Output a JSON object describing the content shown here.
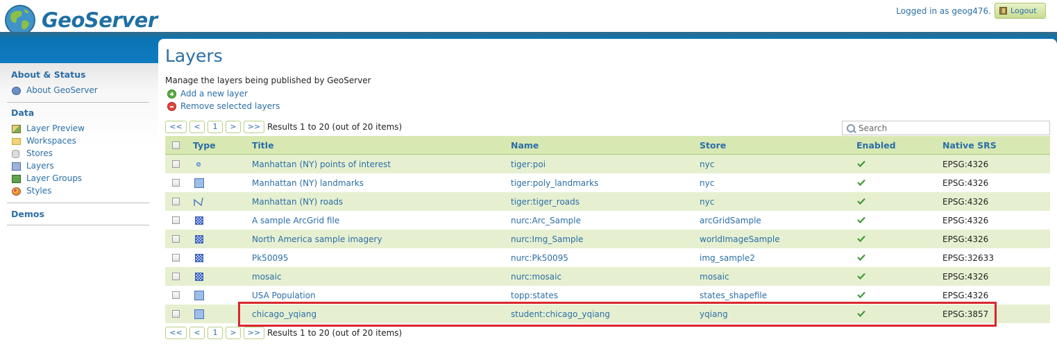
{
  "header": {
    "app_name": "GeoServer",
    "logged_in_text": "Logged in as geog476.",
    "logout_label": "Logout"
  },
  "sidebar": {
    "sections": [
      {
        "title": "About & Status",
        "items": [
          {
            "label": "About GeoServer",
            "icon": "info-icon"
          }
        ]
      },
      {
        "title": "Data",
        "items": [
          {
            "label": "Layer Preview",
            "icon": "layer-preview-icon"
          },
          {
            "label": "Workspaces",
            "icon": "folder-icon"
          },
          {
            "label": "Stores",
            "icon": "database-icon"
          },
          {
            "label": "Layers",
            "icon": "layers-icon"
          },
          {
            "label": "Layer Groups",
            "icon": "layer-groups-icon"
          },
          {
            "label": "Styles",
            "icon": "palette-icon"
          }
        ]
      },
      {
        "title": "Demos",
        "items": []
      }
    ]
  },
  "main": {
    "title": "Layers",
    "description": "Manage the layers being published by GeoServer",
    "add_label": "Add a new layer",
    "remove_label": "Remove selected layers",
    "pager": {
      "first": "<<",
      "prev": "<",
      "page": "1",
      "next": ">",
      "last": ">>",
      "info": "Results 1 to 20 (out of 20 items)"
    },
    "search_placeholder": "Search",
    "columns": [
      "Type",
      "Title",
      "Name",
      "Store",
      "Enabled",
      "Native SRS"
    ],
    "rows": [
      {
        "type": "point",
        "title": "Manhattan (NY) points of interest",
        "name": "tiger:poi",
        "store": "nyc",
        "enabled": true,
        "srs": "EPSG:4326"
      },
      {
        "type": "polygon",
        "title": "Manhattan (NY) landmarks",
        "name": "tiger:poly_landmarks",
        "store": "nyc",
        "enabled": true,
        "srs": "EPSG:4326"
      },
      {
        "type": "line",
        "title": "Manhattan (NY) roads",
        "name": "tiger:tiger_roads",
        "store": "nyc",
        "enabled": true,
        "srs": "EPSG:4326"
      },
      {
        "type": "raster",
        "title": "A sample ArcGrid file",
        "name": "nurc:Arc_Sample",
        "store": "arcGridSample",
        "enabled": true,
        "srs": "EPSG:4326"
      },
      {
        "type": "raster",
        "title": "North America sample imagery",
        "name": "nurc:Img_Sample",
        "store": "worldImageSample",
        "enabled": true,
        "srs": "EPSG:4326"
      },
      {
        "type": "raster",
        "title": "Pk50095",
        "name": "nurc:Pk50095",
        "store": "img_sample2",
        "enabled": true,
        "srs": "EPSG:32633"
      },
      {
        "type": "raster",
        "title": "mosaic",
        "name": "nurc:mosaic",
        "store": "mosaic",
        "enabled": true,
        "srs": "EPSG:4326"
      },
      {
        "type": "polygon",
        "title": "USA Population",
        "name": "topp:states",
        "store": "states_shapefile",
        "enabled": true,
        "srs": "EPSG:4326"
      },
      {
        "type": "polygon",
        "title": "chicago_yqiang",
        "name": "student:chicago_yqiang",
        "store": "yqiang",
        "enabled": true,
        "srs": "EPSG:3857"
      }
    ]
  },
  "colors": {
    "accent_blue": "#2b6ea6",
    "header_band": "#0f7bc0",
    "table_header": "#d8e8b3",
    "row_alt": "#e6f0d0",
    "highlight": "#d9262b",
    "enabled_check": "#3e9a35"
  }
}
